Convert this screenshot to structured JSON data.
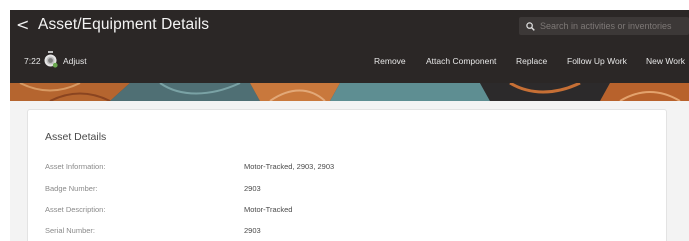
{
  "header": {
    "back_glyph": "<",
    "title": "Asset/Equipment Details",
    "search": {
      "placeholder": "Search in activities or inventories",
      "icon": "search-icon"
    }
  },
  "toolbar": {
    "time": "7:22",
    "clock_icon": "stopwatch-icon",
    "adjust_label": "Adjust",
    "actions": [
      "Remove",
      "Attach Component",
      "Replace",
      "Follow Up Work",
      "New Work"
    ]
  },
  "asset_details": {
    "title": "Asset Details",
    "rows": [
      {
        "label": "Asset Information:",
        "value": "Motor-Tracked, 2903, 2903"
      },
      {
        "label": "Badge Number:",
        "value": "2903"
      },
      {
        "label": "Asset Description:",
        "value": "Motor-Tracked"
      },
      {
        "label": "Serial Number:",
        "value": "2903"
      }
    ]
  },
  "colors": {
    "header_bg": "#2b2726",
    "search_bg": "#3c3837",
    "content_bg": "#f3f3f3",
    "banner_orange": "#c8743a",
    "banner_teal": "#5c8f93"
  }
}
